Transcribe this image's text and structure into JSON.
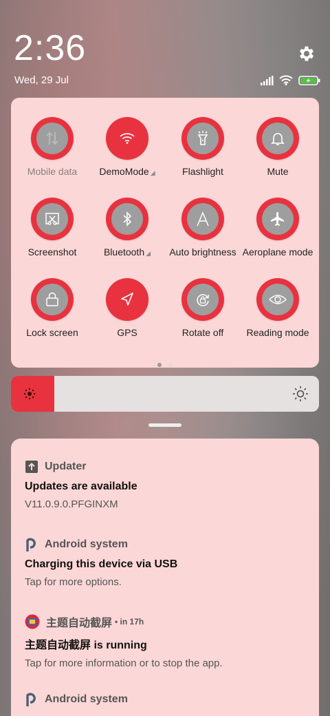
{
  "status": {
    "time": "2:36",
    "date": "Wed, 29 Jul",
    "icons": [
      "signal-icon",
      "wifi-icon",
      "battery-charging-icon"
    ]
  },
  "quick_settings": {
    "tiles": [
      {
        "label": "Mobile data",
        "icon": "mobile-data-icon",
        "active": false,
        "has_arrow": false
      },
      {
        "label": "DemoMode",
        "icon": "wifi-icon",
        "active": true,
        "has_arrow": true
      },
      {
        "label": "Flashlight",
        "icon": "flashlight-icon",
        "active": false,
        "has_arrow": false
      },
      {
        "label": "Mute",
        "icon": "bell-icon",
        "active": false,
        "has_arrow": false
      },
      {
        "label": "Screenshot",
        "icon": "screenshot-icon",
        "active": false,
        "has_arrow": false
      },
      {
        "label": "Bluetooth",
        "icon": "bluetooth-icon",
        "active": false,
        "has_arrow": true
      },
      {
        "label": "Auto brightness",
        "icon": "auto-brightness-icon",
        "active": false,
        "has_arrow": false
      },
      {
        "label": "Aeroplane mode",
        "icon": "airplane-icon",
        "active": false,
        "has_arrow": false
      },
      {
        "label": "Lock screen",
        "icon": "lock-icon",
        "active": false,
        "has_arrow": false
      },
      {
        "label": "GPS",
        "icon": "gps-icon",
        "active": true,
        "has_arrow": false
      },
      {
        "label": "Rotate off",
        "icon": "rotate-lock-icon",
        "active": false,
        "has_arrow": false
      },
      {
        "label": "Reading mode",
        "icon": "eye-icon",
        "active": false,
        "has_arrow": false
      }
    ],
    "page_index": 1,
    "page_count": 2
  },
  "brightness": {
    "level": 0.14
  },
  "notifications": [
    {
      "app": "Updater",
      "time": "",
      "icon": "updater-icon",
      "title": "Updates are available",
      "text": "V11.0.9.0.PFGINXM"
    },
    {
      "app": "Android system",
      "time": "",
      "icon": "android-system-icon",
      "title": "Charging this device via USB",
      "text": "Tap for more options."
    },
    {
      "app": "主题自动截屏",
      "time": "• in 17h",
      "icon": "app-icon",
      "title": "主题自动截屏 is running",
      "text": "Tap for more information or to stop the app."
    },
    {
      "app": "Android system",
      "time": "",
      "icon": "android-system-icon",
      "title": "",
      "text": ""
    }
  ],
  "colors": {
    "accent": "#e8323f",
    "panel": "#fcd7d7",
    "tile_inactive": "#9e9e9e"
  }
}
